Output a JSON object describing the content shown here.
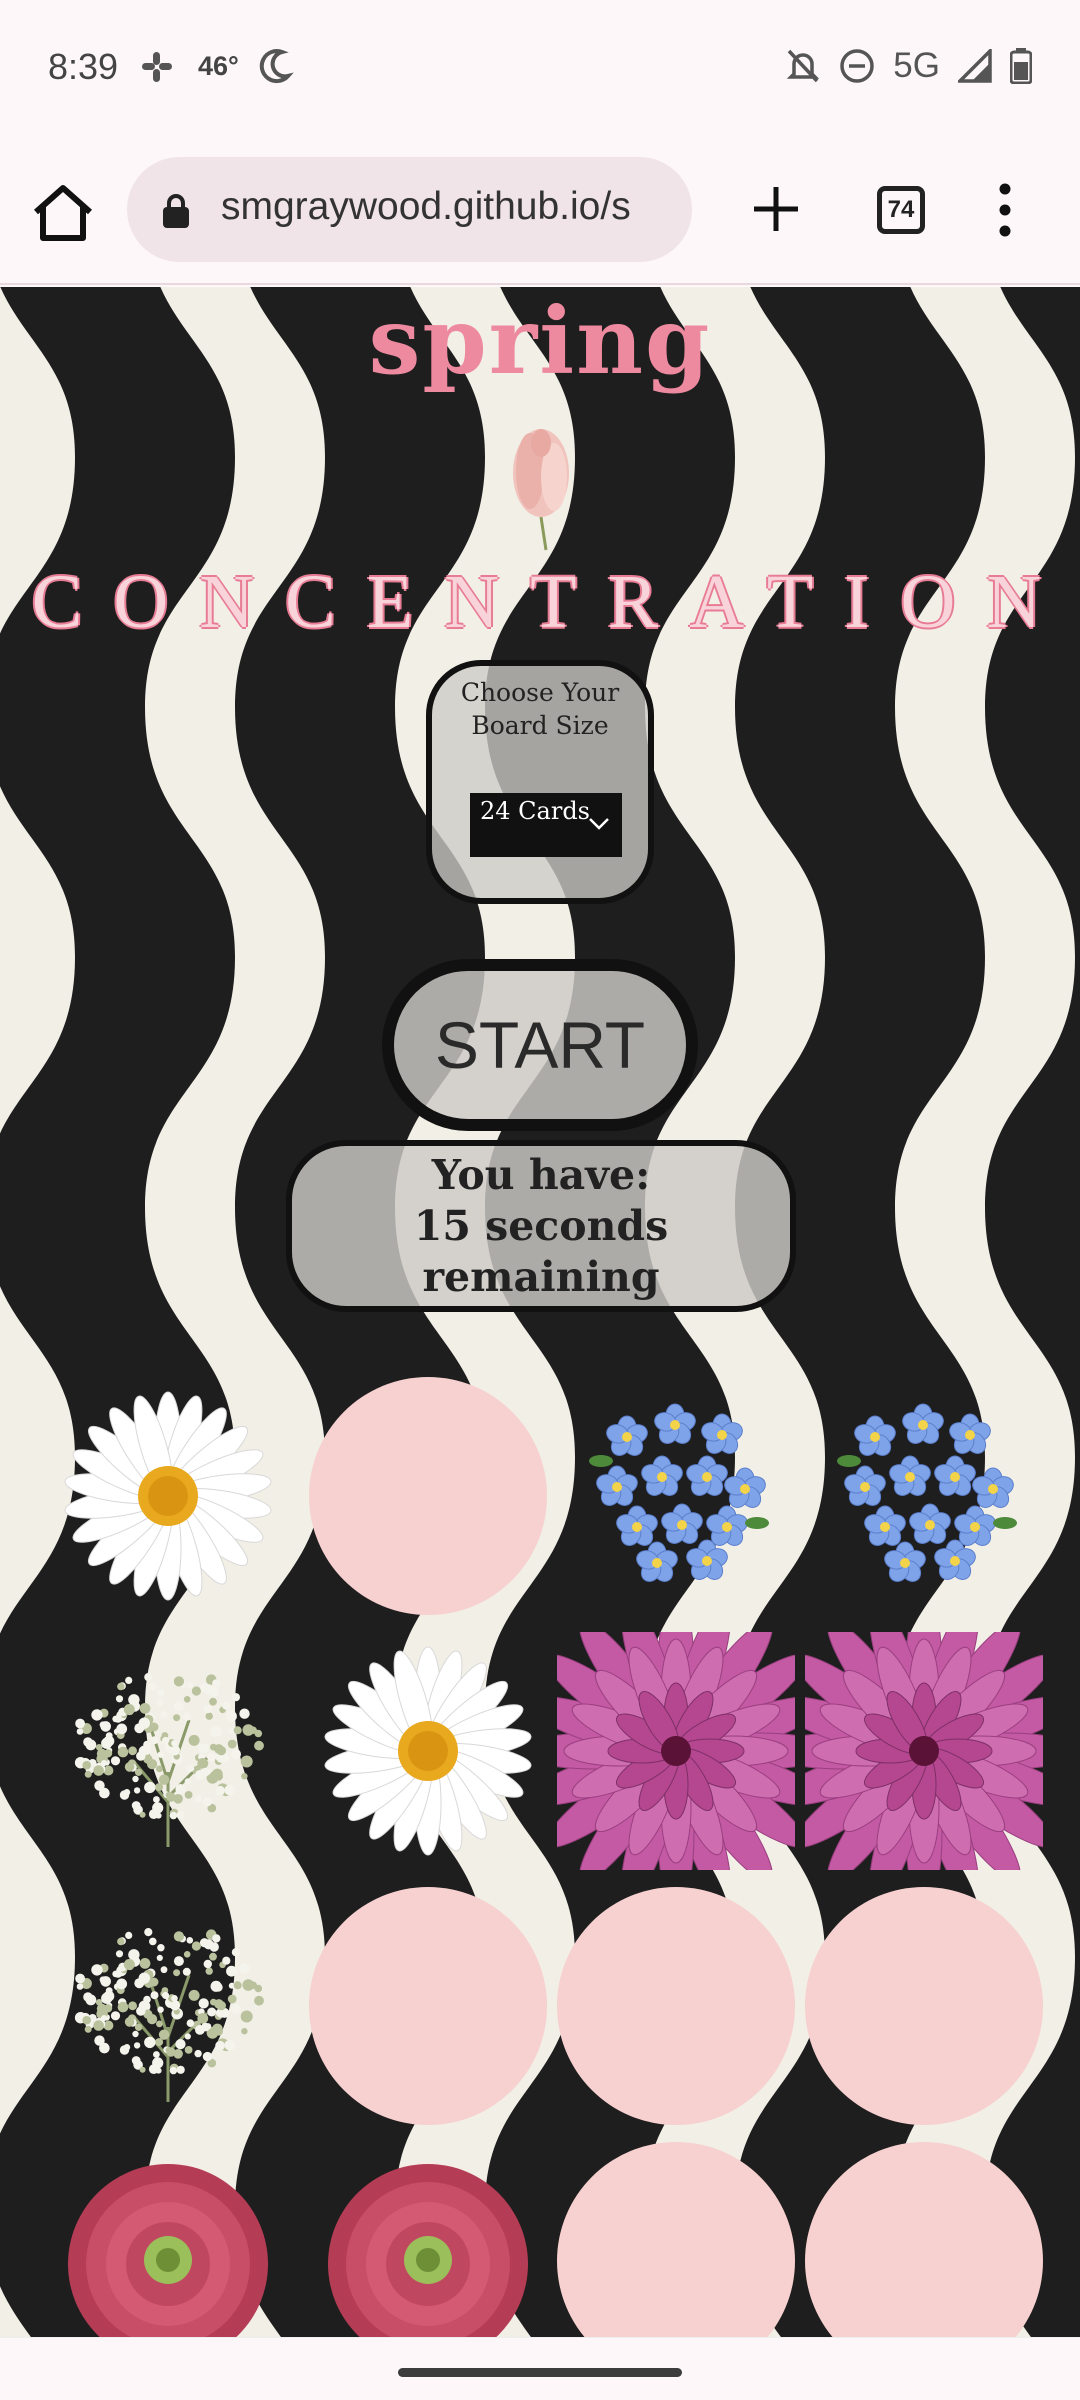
{
  "status_bar": {
    "time": "8:39",
    "temperature": "46°",
    "network": "5G",
    "icons": [
      "slack-icon",
      "moon-icon",
      "bell-off-icon",
      "do-not-disturb-icon",
      "signal-icon",
      "battery-icon"
    ]
  },
  "browser": {
    "url": "smgraywood.github.io/s",
    "tab_count": "74",
    "icons": [
      "home-icon",
      "lock-icon",
      "plus-icon",
      "tabs-icon",
      "more-vert-icon"
    ]
  },
  "game": {
    "brand": "spring",
    "title": "CONCENTRATION",
    "board_size_label": "Choose Your Board Size",
    "board_size_selected": "24 Cards",
    "start_label": "START",
    "timer_line1": "You have:",
    "timer_line2": "15 seconds",
    "timer_line3": "remaining"
  },
  "cards": [
    {
      "state": "face-up",
      "flower": "daisy"
    },
    {
      "state": "face-down",
      "flower": ""
    },
    {
      "state": "face-up",
      "flower": "forget-me-not"
    },
    {
      "state": "face-up",
      "flower": "forget-me-not"
    },
    {
      "state": "face-up",
      "flower": "babys-breath"
    },
    {
      "state": "face-up",
      "flower": "daisy"
    },
    {
      "state": "face-up",
      "flower": "dahlia"
    },
    {
      "state": "face-up",
      "flower": "dahlia"
    },
    {
      "state": "face-up",
      "flower": "babys-breath"
    },
    {
      "state": "face-down",
      "flower": ""
    },
    {
      "state": "face-down",
      "flower": ""
    },
    {
      "state": "face-down",
      "flower": ""
    },
    {
      "state": "face-up",
      "flower": "ranunculus"
    },
    {
      "state": "face-up",
      "flower": "ranunculus"
    },
    {
      "state": "face-down",
      "flower": ""
    },
    {
      "state": "face-down",
      "flower": ""
    }
  ],
  "colors": {
    "accent_pink": "#ee8aa0",
    "card_back": "#f7d0d0",
    "stripe_dark": "#1f1e1f",
    "stripe_light": "#f2efe6"
  }
}
